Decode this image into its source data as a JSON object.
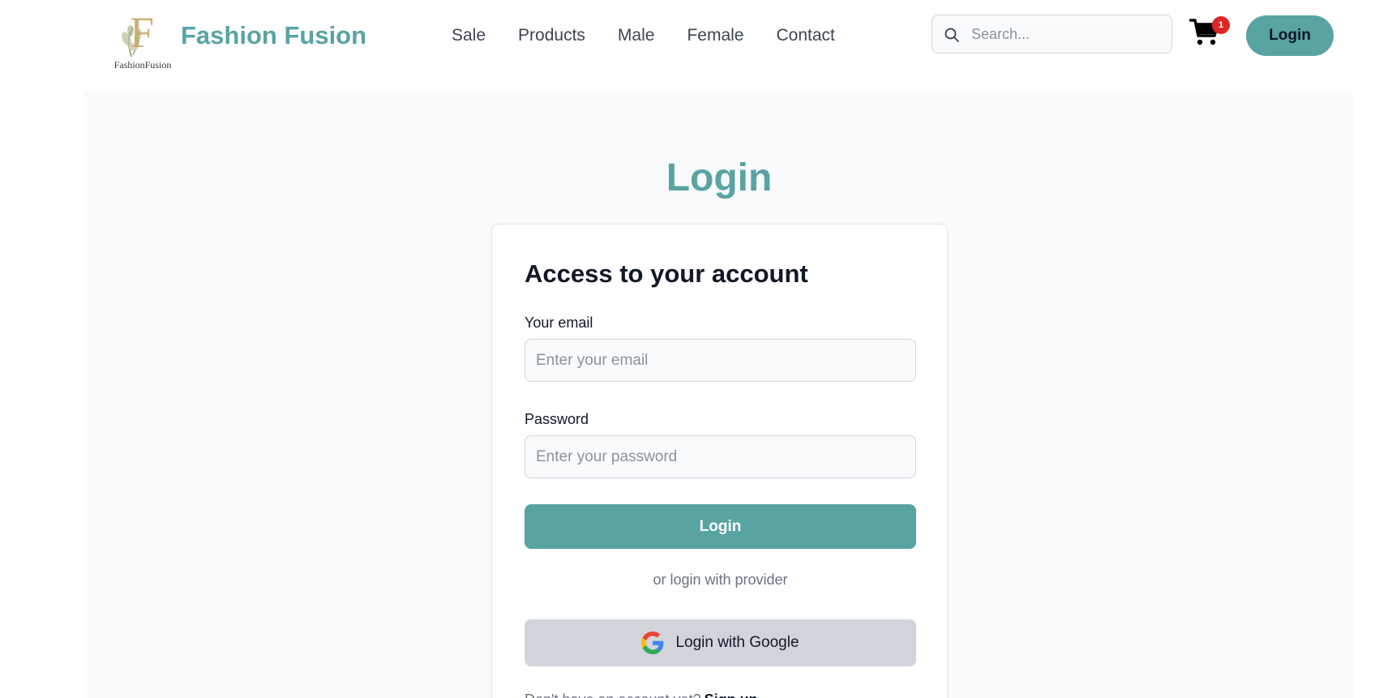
{
  "header": {
    "logo_text": "FashionFusion",
    "logo_letter": "F",
    "brand_name": "Fashion Fusion",
    "nav": [
      {
        "label": "Sale"
      },
      {
        "label": "Products"
      },
      {
        "label": "Male"
      },
      {
        "label": "Female"
      },
      {
        "label": "Contact"
      }
    ],
    "search": {
      "placeholder": "Search...",
      "value": ""
    },
    "cart": {
      "count": "1",
      "icon": "cart-icon"
    },
    "login_label": "Login"
  },
  "main": {
    "page_title": "Login",
    "card": {
      "title": "Access to your account",
      "email": {
        "label": "Your email",
        "placeholder": "Enter your email",
        "value": ""
      },
      "password": {
        "label": "Password",
        "placeholder": "Enter your password",
        "value": ""
      },
      "submit_label": "Login",
      "divider_text": "or login with provider",
      "google_label": "Login with Google",
      "signup_text": "Don't have an account yet?",
      "signup_link": "Sign up"
    }
  },
  "colors": {
    "accent": "#59a3a3",
    "badge": "#dc2626",
    "google_button_bg": "#d1d5db",
    "page_bg": "#f9fafb"
  }
}
